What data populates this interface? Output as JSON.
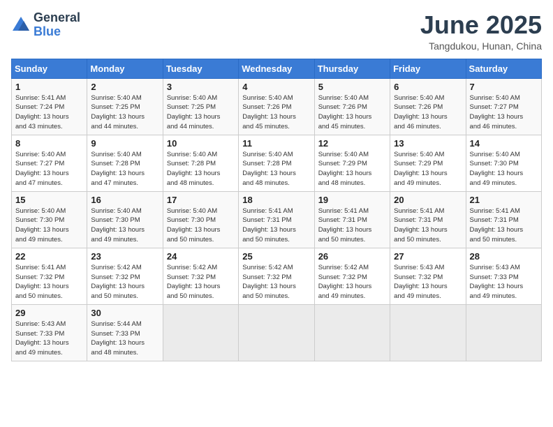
{
  "header": {
    "logo_general": "General",
    "logo_blue": "Blue",
    "title": "June 2025",
    "subtitle": "Tangdukou, Hunan, China"
  },
  "weekdays": [
    "Sunday",
    "Monday",
    "Tuesday",
    "Wednesday",
    "Thursday",
    "Friday",
    "Saturday"
  ],
  "weeks": [
    [
      {
        "day": "1",
        "info": "Sunrise: 5:41 AM\nSunset: 7:24 PM\nDaylight: 13 hours\nand 43 minutes."
      },
      {
        "day": "2",
        "info": "Sunrise: 5:40 AM\nSunset: 7:25 PM\nDaylight: 13 hours\nand 44 minutes."
      },
      {
        "day": "3",
        "info": "Sunrise: 5:40 AM\nSunset: 7:25 PM\nDaylight: 13 hours\nand 44 minutes."
      },
      {
        "day": "4",
        "info": "Sunrise: 5:40 AM\nSunset: 7:26 PM\nDaylight: 13 hours\nand 45 minutes."
      },
      {
        "day": "5",
        "info": "Sunrise: 5:40 AM\nSunset: 7:26 PM\nDaylight: 13 hours\nand 45 minutes."
      },
      {
        "day": "6",
        "info": "Sunrise: 5:40 AM\nSunset: 7:26 PM\nDaylight: 13 hours\nand 46 minutes."
      },
      {
        "day": "7",
        "info": "Sunrise: 5:40 AM\nSunset: 7:27 PM\nDaylight: 13 hours\nand 46 minutes."
      }
    ],
    [
      {
        "day": "8",
        "info": "Sunrise: 5:40 AM\nSunset: 7:27 PM\nDaylight: 13 hours\nand 47 minutes."
      },
      {
        "day": "9",
        "info": "Sunrise: 5:40 AM\nSunset: 7:28 PM\nDaylight: 13 hours\nand 47 minutes."
      },
      {
        "day": "10",
        "info": "Sunrise: 5:40 AM\nSunset: 7:28 PM\nDaylight: 13 hours\nand 48 minutes."
      },
      {
        "day": "11",
        "info": "Sunrise: 5:40 AM\nSunset: 7:28 PM\nDaylight: 13 hours\nand 48 minutes."
      },
      {
        "day": "12",
        "info": "Sunrise: 5:40 AM\nSunset: 7:29 PM\nDaylight: 13 hours\nand 48 minutes."
      },
      {
        "day": "13",
        "info": "Sunrise: 5:40 AM\nSunset: 7:29 PM\nDaylight: 13 hours\nand 49 minutes."
      },
      {
        "day": "14",
        "info": "Sunrise: 5:40 AM\nSunset: 7:30 PM\nDaylight: 13 hours\nand 49 minutes."
      }
    ],
    [
      {
        "day": "15",
        "info": "Sunrise: 5:40 AM\nSunset: 7:30 PM\nDaylight: 13 hours\nand 49 minutes."
      },
      {
        "day": "16",
        "info": "Sunrise: 5:40 AM\nSunset: 7:30 PM\nDaylight: 13 hours\nand 49 minutes."
      },
      {
        "day": "17",
        "info": "Sunrise: 5:40 AM\nSunset: 7:30 PM\nDaylight: 13 hours\nand 50 minutes."
      },
      {
        "day": "18",
        "info": "Sunrise: 5:41 AM\nSunset: 7:31 PM\nDaylight: 13 hours\nand 50 minutes."
      },
      {
        "day": "19",
        "info": "Sunrise: 5:41 AM\nSunset: 7:31 PM\nDaylight: 13 hours\nand 50 minutes."
      },
      {
        "day": "20",
        "info": "Sunrise: 5:41 AM\nSunset: 7:31 PM\nDaylight: 13 hours\nand 50 minutes."
      },
      {
        "day": "21",
        "info": "Sunrise: 5:41 AM\nSunset: 7:31 PM\nDaylight: 13 hours\nand 50 minutes."
      }
    ],
    [
      {
        "day": "22",
        "info": "Sunrise: 5:41 AM\nSunset: 7:32 PM\nDaylight: 13 hours\nand 50 minutes."
      },
      {
        "day": "23",
        "info": "Sunrise: 5:42 AM\nSunset: 7:32 PM\nDaylight: 13 hours\nand 50 minutes."
      },
      {
        "day": "24",
        "info": "Sunrise: 5:42 AM\nSunset: 7:32 PM\nDaylight: 13 hours\nand 50 minutes."
      },
      {
        "day": "25",
        "info": "Sunrise: 5:42 AM\nSunset: 7:32 PM\nDaylight: 13 hours\nand 50 minutes."
      },
      {
        "day": "26",
        "info": "Sunrise: 5:42 AM\nSunset: 7:32 PM\nDaylight: 13 hours\nand 49 minutes."
      },
      {
        "day": "27",
        "info": "Sunrise: 5:43 AM\nSunset: 7:32 PM\nDaylight: 13 hours\nand 49 minutes."
      },
      {
        "day": "28",
        "info": "Sunrise: 5:43 AM\nSunset: 7:33 PM\nDaylight: 13 hours\nand 49 minutes."
      }
    ],
    [
      {
        "day": "29",
        "info": "Sunrise: 5:43 AM\nSunset: 7:33 PM\nDaylight: 13 hours\nand 49 minutes."
      },
      {
        "day": "30",
        "info": "Sunrise: 5:44 AM\nSunset: 7:33 PM\nDaylight: 13 hours\nand 48 minutes."
      },
      {
        "day": "",
        "info": ""
      },
      {
        "day": "",
        "info": ""
      },
      {
        "day": "",
        "info": ""
      },
      {
        "day": "",
        "info": ""
      },
      {
        "day": "",
        "info": ""
      }
    ]
  ]
}
